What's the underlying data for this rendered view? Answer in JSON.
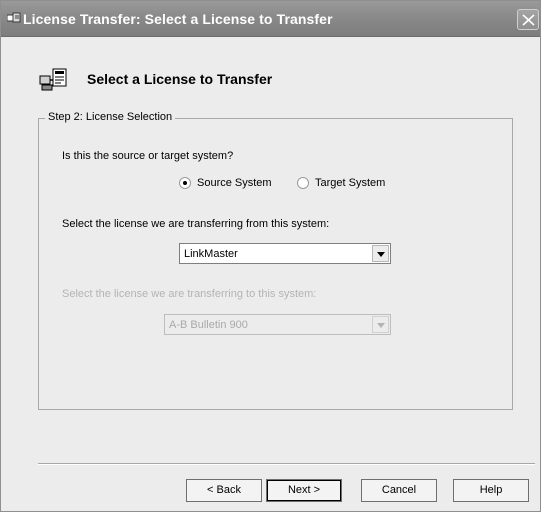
{
  "window": {
    "title": "License Transfer: Select a License to Transfer"
  },
  "header": {
    "title": "Select a License to Transfer"
  },
  "group": {
    "legend": "Step 2: License Selection",
    "question": "Is this the source or target system?",
    "radio_source": "Source System",
    "radio_target": "Target System",
    "selected": "Source System",
    "from_label": "Select the license we are transferring from this system:",
    "from_value": "LinkMaster",
    "to_label": "Select the license we are transferring to this system:",
    "to_value": "A-B Bulletin 900"
  },
  "buttons": {
    "back": "< Back",
    "next": "Next >",
    "cancel": "Cancel",
    "help": "Help"
  }
}
